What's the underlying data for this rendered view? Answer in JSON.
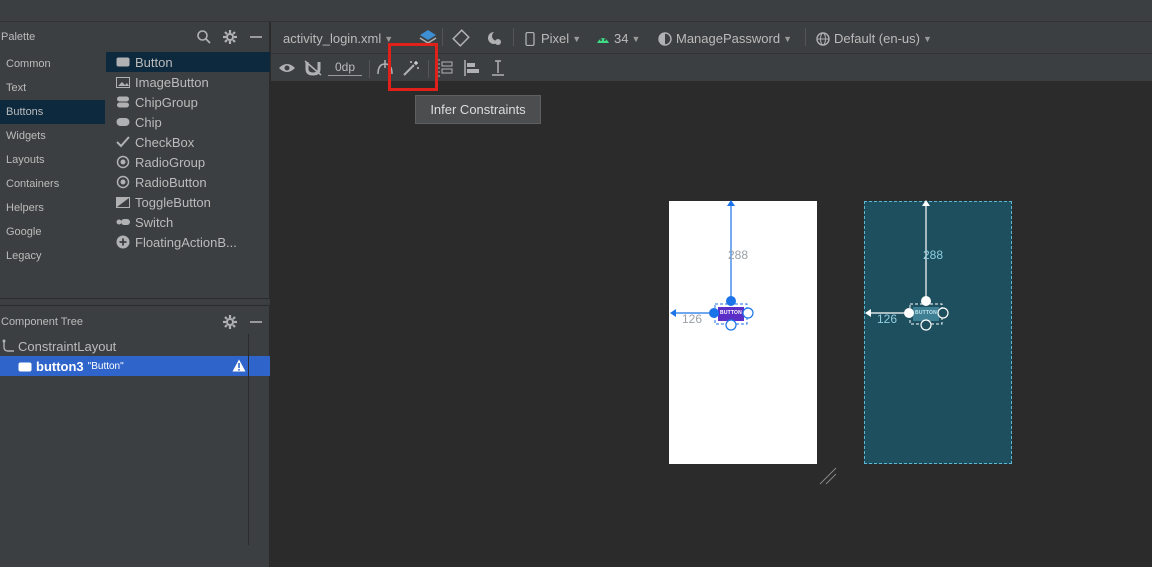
{
  "palette": {
    "title": "Palette",
    "categories": [
      "Common",
      "Text",
      "Buttons",
      "Widgets",
      "Layouts",
      "Containers",
      "Helpers",
      "Google",
      "Legacy"
    ],
    "selected_category": "Buttons",
    "widgets": [
      {
        "label": "Button",
        "icon": "button-icon"
      },
      {
        "label": "ImageButton",
        "icon": "image-button-icon"
      },
      {
        "label": "ChipGroup",
        "icon": "chip-group-icon"
      },
      {
        "label": "Chip",
        "icon": "chip-icon"
      },
      {
        "label": "CheckBox",
        "icon": "checkmark-icon"
      },
      {
        "label": "RadioGroup",
        "icon": "radio-group-icon"
      },
      {
        "label": "RadioButton",
        "icon": "radio-button-icon"
      },
      {
        "label": "ToggleButton",
        "icon": "toggle-button-icon"
      },
      {
        "label": "Switch",
        "icon": "switch-icon"
      },
      {
        "label": "FloatingActionB...",
        "icon": "plus-circle-icon"
      }
    ]
  },
  "component_tree": {
    "title": "Component Tree",
    "root": "ConstraintLayout",
    "child": {
      "name": "button3",
      "text": "\"Button\""
    }
  },
  "toolbar": {
    "file": "activity_login.xml",
    "device": "Pixel",
    "api": "34",
    "theme": "ManagePassword",
    "locale": "Default (en-us)",
    "margin": "0dp"
  },
  "tooltip": "Infer Constraints",
  "canvas": {
    "vertical_margin": "288",
    "horizontal_margin": "126",
    "button_text": "BUTTON"
  },
  "colors": {
    "accent": "#2f65ca",
    "highlight": "#e0201b",
    "blueprint": "#1d4f5e",
    "constraint": "#1a73e8"
  }
}
